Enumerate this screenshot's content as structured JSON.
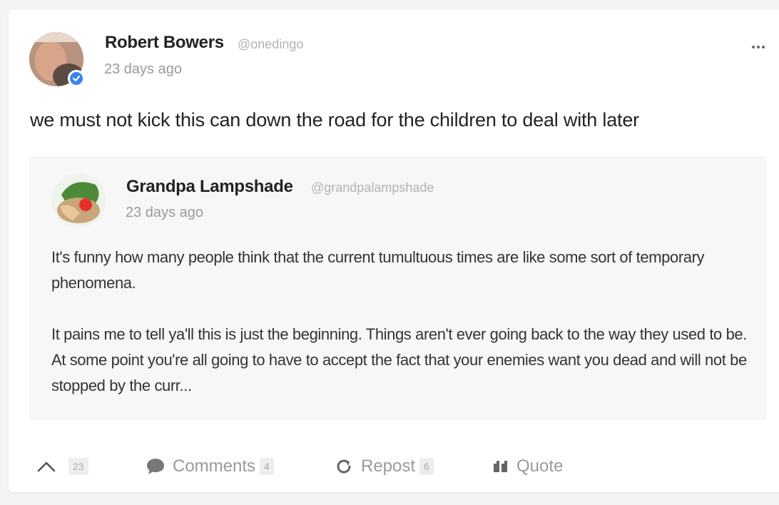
{
  "post": {
    "author_name": "Robert Bowers",
    "author_handle": "@onedingo",
    "time": "23 days ago",
    "text": "we must not kick this can down the road for the children to deal with later",
    "more_label": "..."
  },
  "quoted_post": {
    "author_name": "Grandpa Lampshade",
    "author_handle": "@grandpalampshade",
    "time": "23 days ago",
    "paragraphs": [
      "It's funny how many people think that the current tumultuous times are like some sort of temporary phenomena.",
      "It pains me to tell ya'll this is just the beginning. Things aren't ever going back to the way they used to be. At some point you're all going to have to accept the fact that your enemies want you dead and will not be stopped by the curr..."
    ]
  },
  "actions": {
    "upvote_count": "23",
    "comments_label": "Comments",
    "comments_count": "4",
    "repost_label": "Repost",
    "repost_count": "6",
    "quote_label": "Quote"
  },
  "colors": {
    "verified": "#3b82f6",
    "muted_text": "#9a9a9a",
    "quote_background": "#f7f7f7"
  },
  "icons": [
    "verified-badge-icon",
    "more-options-icon",
    "upvote-chevron-icon",
    "comment-bubble-icon",
    "repost-arrow-icon",
    "quote-marks-icon"
  ]
}
